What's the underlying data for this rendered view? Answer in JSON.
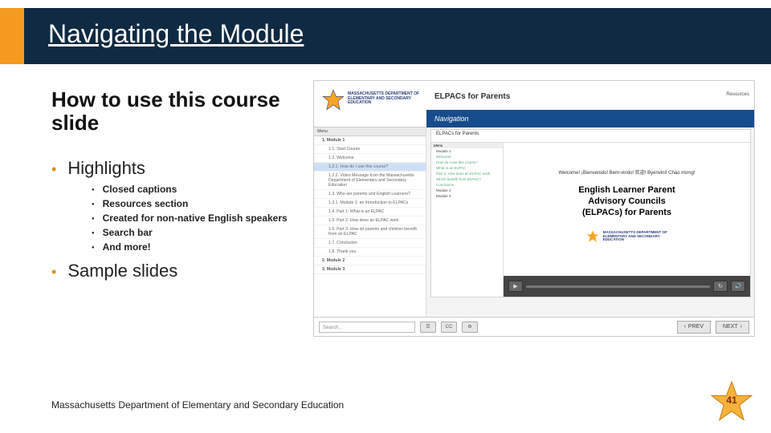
{
  "header": {
    "title": "Navigating the Module"
  },
  "left": {
    "subtitle": "How to use this course slide",
    "bullets": [
      {
        "label": "Highlights"
      },
      {
        "label": "Sample slides"
      }
    ],
    "highlights": [
      "Closed captions",
      "Resources section",
      "Created for non-native English speakers",
      "Search bar",
      "And more!"
    ]
  },
  "mock": {
    "logo_text": "MASSACHUSETTS DEPARTMENT OF\nELEMENTARY AND SECONDARY\nEDUCATION",
    "course_title": "ELPACs for Parents",
    "resources_link": "Resources",
    "nav_label": "Navigation",
    "menu_header": "Menu",
    "menu": [
      {
        "label": "1. Module 1",
        "sub": [
          "1.1. Start Course",
          "1.2. Welcome",
          "1.2.1. How do I use this course?",
          "1.2.2. Video Message from the Massachusetts Department of Elementary and Secondary Education",
          "1.3. Who are parents and English Learners?",
          "1.3.1. Module 1: an Introduction to ELPACs",
          "1.4. Part 1: What is an ELPAC",
          "1.5. Part 2: How does an ELPAC work",
          "1.6. Part 3: How do parents and children benefit from an ELPAC",
          "1.7. Conclusion",
          "1.8. Thank you"
        ]
      },
      {
        "label": "2. Module 2",
        "sub": []
      },
      {
        "label": "3. Module 3",
        "sub": []
      }
    ],
    "active_index": 2,
    "inner": {
      "top_title": "ELPACs for Parents",
      "nav_label": "ELPACs for Parents",
      "menu_items": [
        "Module 1",
        "Welcome",
        "How do I use this course?",
        "What is an ELPAC",
        "Part 2: How does an ELPAC work",
        "Which benefit from ELPAC?",
        "Conclusion",
        "Module 2",
        "Module 3"
      ],
      "welcome_line": "Welcome! ¡Bienvenido! Bem-vindo! 欢迎! Byenvini! Chào mừng!",
      "big_title": "English Learner Parent\nAdvisory Councils\n(ELPACs) for Parents"
    },
    "controls": {
      "play": "▶",
      "volume": "🔊",
      "replay": "↻"
    },
    "bottom": {
      "search_placeholder": "Search…",
      "prev": "PREV",
      "next": "NEXT"
    }
  },
  "footer": {
    "text": "Massachusetts Department of Elementary and Secondary Education",
    "page_number": "41"
  },
  "colors": {
    "accent_orange": "#f39a1f",
    "navy": "#0f2a42",
    "link_blue": "#184b8c"
  }
}
